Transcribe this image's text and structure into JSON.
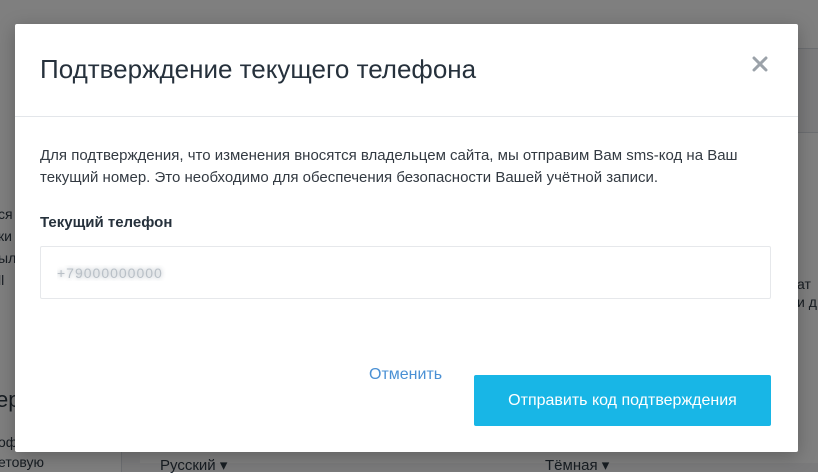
{
  "background": {
    "fragments": [
      "ся",
      "ки",
      "ыл",
      "ll",
      "ат",
      "и д"
    ],
    "heading_fragment": "ер",
    "bottom_fragments": [
      "оф",
      "етовую"
    ],
    "language_select": "Русский",
    "theme_select": "Тёмная"
  },
  "modal": {
    "title": "Подтверждение текущего телефона",
    "close_icon": "close-icon",
    "description": "Для подтверждения, что изменения вносятся владельцем сайта, мы отправим Вам sms-код на Ваш текущий номер. Это необходимо для обеспечения безопасности Вашей учётной записи.",
    "phone_label": "Текущий телефон",
    "phone_value": "+79000000000",
    "cancel_label": "Отменить",
    "submit_label": "Отправить код подтверждения"
  },
  "colors": {
    "accent": "#18b6e6",
    "link": "#4a90d4"
  }
}
